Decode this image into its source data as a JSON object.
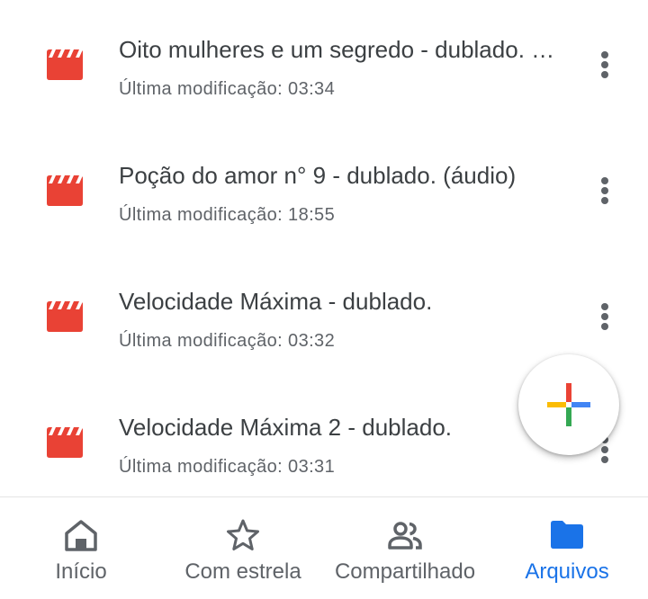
{
  "files": [
    {
      "name": "Oito mulheres e um segredo - dublado. (áudio)",
      "meta": "Última modificação: 03:34",
      "icon": "video-file-icon"
    },
    {
      "name": "Poção do amor n° 9 - dublado. (áudio)",
      "meta": "Última modificação: 18:55",
      "icon": "video-file-icon"
    },
    {
      "name": "Velocidade Máxima - dublado.",
      "meta": "Última modificação: 03:32",
      "icon": "video-file-icon"
    },
    {
      "name": "Velocidade Máxima 2 - dublado.",
      "meta": "Última modificação: 03:31",
      "icon": "video-file-icon"
    }
  ],
  "fab": {
    "icon": "google-plus-icon"
  },
  "bottom_nav": {
    "items": [
      {
        "label": "Início",
        "icon": "home-icon",
        "active": false
      },
      {
        "label": "Com estrela",
        "icon": "star-icon",
        "active": false
      },
      {
        "label": "Compartilhado",
        "icon": "people-icon",
        "active": false
      },
      {
        "label": "Arquivos",
        "icon": "folder-icon",
        "active": true
      }
    ]
  },
  "colors": {
    "file_icon": "#e94235",
    "active": "#1a73e8",
    "inactive": "#5f6368",
    "plus_red": "#ea4335",
    "plus_blue": "#4285f4",
    "plus_green": "#34a853",
    "plus_yellow": "#fbbc04"
  }
}
